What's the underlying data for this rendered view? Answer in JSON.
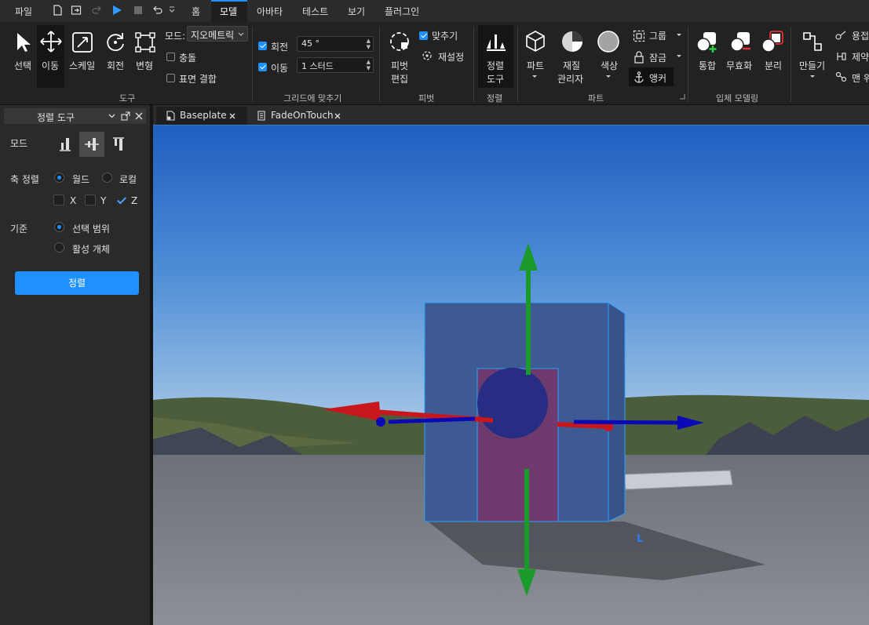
{
  "menu": {
    "file": "파일",
    "tabs": [
      "홈",
      "모델",
      "아바타",
      "테스트",
      "보기",
      "플러그인"
    ],
    "active_tab": "모델"
  },
  "ribbon": {
    "tools": {
      "select": "선택",
      "move": "이동",
      "scale": "스케일",
      "rotate": "회전",
      "transform": "변형",
      "mode_label": "모드:",
      "mode_value": "지오메트릭",
      "collisions": "충돌",
      "join_surfaces": "표면 결합",
      "group_label": "도구"
    },
    "snap": {
      "rotate_label": "회전",
      "rotate_value": "45 °",
      "move_label": "이동",
      "move_value": "1 스터드",
      "group_label": "그리드에 맞추기"
    },
    "pivot": {
      "edit_line1": "피벗",
      "edit_line2": "편집",
      "snap": "맞추기",
      "reset": "재설정",
      "group_label": "피벗"
    },
    "align": {
      "tool_line1": "정렬",
      "tool_line2": "도구",
      "group_label": "정렬"
    },
    "part": {
      "part": "파트",
      "material_line1": "재질",
      "material_line2": "관리자",
      "color": "색상",
      "group": "그룹",
      "lock": "잠금",
      "anchor": "앵커",
      "group_label": "파트"
    },
    "solid": {
      "union": "통합",
      "negate": "무효화",
      "separate": "분리",
      "group_label": "입체 모델링"
    },
    "constraints": {
      "create": "만들기",
      "weld": "용접",
      "constraint": "제약",
      "more": "맨 위"
    }
  },
  "panel": {
    "title": "정렬 도구",
    "mode_label": "모드",
    "axis_label": "축 정렬",
    "world": "월드",
    "local": "로컬",
    "x": "X",
    "y": "Y",
    "z": "Z",
    "axes_checked": {
      "x": false,
      "y": false,
      "z": true
    },
    "reference_label": "기준",
    "selection_bounds": "선택 범위",
    "active_object": "활성 개체",
    "align_button": "정렬"
  },
  "doc_tabs": [
    {
      "label": "Baseplate"
    },
    {
      "label": "FadeOnTouch"
    }
  ],
  "viewport": {
    "cursor_glyph": "L"
  },
  "colors": {
    "accent": "#1e90ff",
    "axis_x": "#c8171c",
    "axis_y": "#1b9a2c",
    "axis_z": "#0a0ab4"
  }
}
